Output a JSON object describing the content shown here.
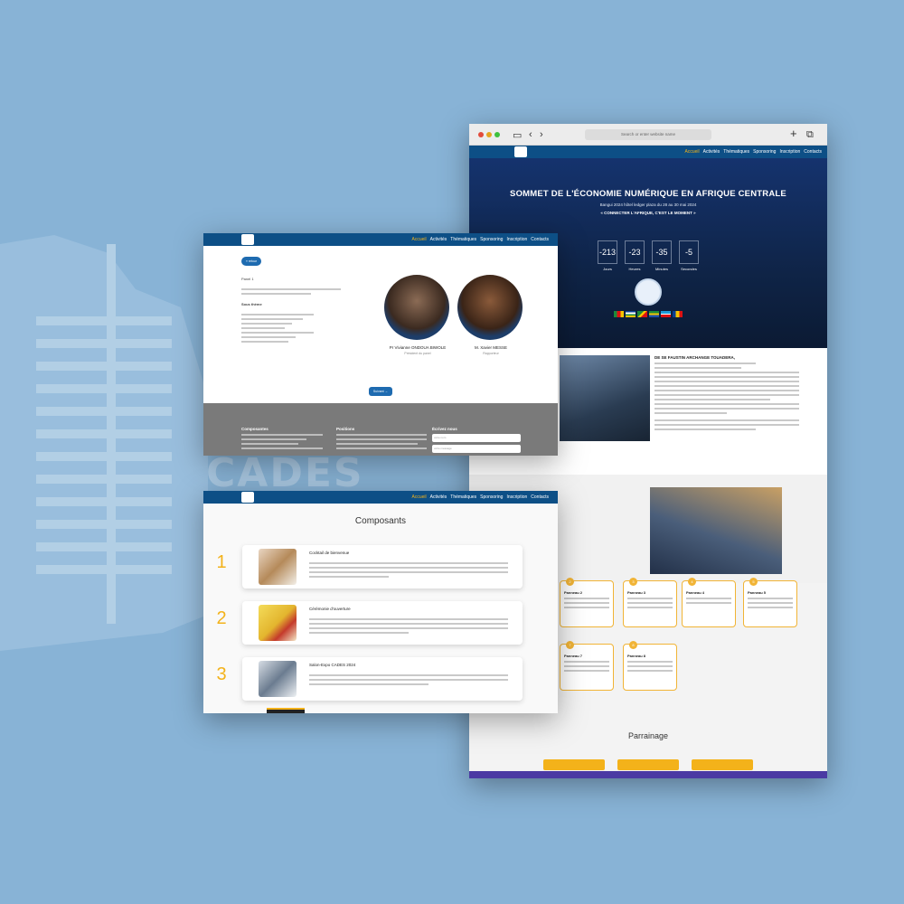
{
  "background_watermark": "CADES",
  "browser": {
    "url_placeholder": "Search or enter website name",
    "nav": [
      "Accueil",
      "Activités",
      "Thématiques",
      "Sponsoring",
      "Inscription",
      "Contacts"
    ],
    "hero_title": "SOMMET DE L'ÉCONOMIE NUMÉRIQUE EN AFRIQUE CENTRALE",
    "hero_sub": "Bangui 2024 hôtel ledger plaza du 28 au 30 mai 2024",
    "hero_tag": "« CONNECTER L'AFRIQUE, C'EST LE MOMENT »",
    "countdown": [
      {
        "value": "-213",
        "label": "Jours"
      },
      {
        "value": "-23",
        "label": "Heures"
      },
      {
        "value": "-35",
        "label": "Minutes"
      },
      {
        "value": "-5",
        "label": "Secondes"
      }
    ],
    "president_heading": "DE SE FAUSTIN ARCHANGE TOUADERA,",
    "panels": [
      {
        "num": "2",
        "title": "Panneau 2"
      },
      {
        "num": "3",
        "title": "Panneau 3"
      },
      {
        "num": "4",
        "title": "Panneau 4"
      },
      {
        "num": "5",
        "title": "Panneau 5"
      },
      {
        "num": "7",
        "title": "Panneau 7"
      },
      {
        "num": "8",
        "title": "Panneau 8"
      }
    ],
    "sponsoring_title": "Parrainage"
  },
  "atelier": {
    "nav": [
      "Accueil",
      "Activités",
      "Thématiques",
      "Sponsoring",
      "Inscription",
      "Contacts"
    ],
    "back_label": "« retour",
    "panel_label": "Panel 1",
    "subtheme_label": "Sous thème",
    "next_label": "Suivant →",
    "speakers": [
      {
        "name": "Pr Vivianne ONDOUA BIWOLE",
        "role": "Président du panel"
      },
      {
        "name": "M. Xavier MESSE",
        "role": "Rapporteur"
      }
    ],
    "footer": {
      "col1_title": "Composantes",
      "col2_title": "Positions",
      "col3_title": "Écrivez nous",
      "input1": "votre nom",
      "input2": "votre message"
    }
  },
  "composants": {
    "nav": [
      "Accueil",
      "Activités",
      "Thématiques",
      "Sponsoring",
      "Inscription",
      "Contacts"
    ],
    "title": "Composants",
    "cards": [
      {
        "num": "1",
        "title": "Cocktail de bienvenue"
      },
      {
        "num": "2",
        "title": "Cérémonie d'ouverture"
      },
      {
        "num": "3",
        "title": "Salon-Expo CADES 2024"
      }
    ]
  },
  "colors": {
    "nav": "#0d4f86",
    "accent": "#f3b21a",
    "background": "#88b3d6"
  }
}
